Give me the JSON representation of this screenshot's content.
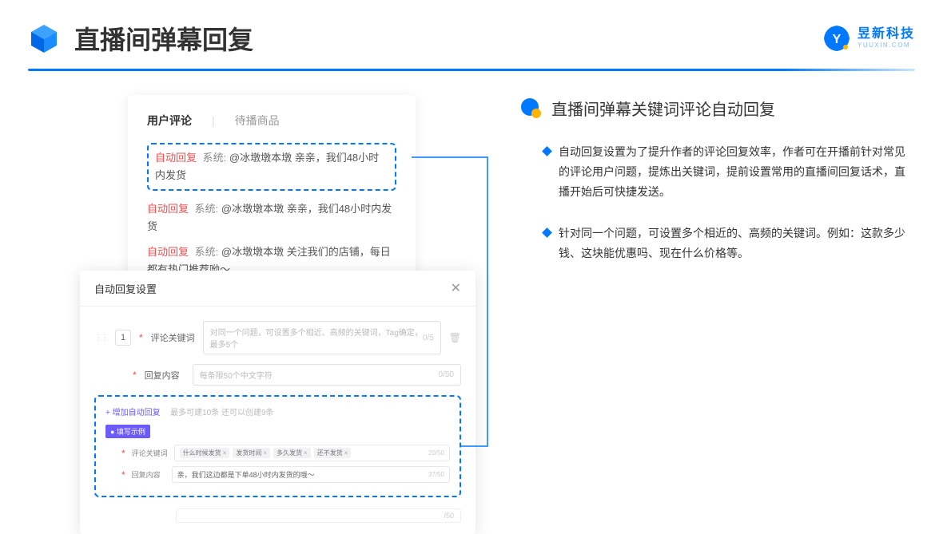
{
  "header": {
    "title": "直播间弹幕回复",
    "logo_name": "昱新科技",
    "logo_domain": "YUUXIN.COM"
  },
  "comments_card": {
    "tab_active": "用户评论",
    "tab_inactive": "待播商品",
    "rows": [
      {
        "tag": "自动回复",
        "sys": "系统:",
        "text": "@冰墩墩本墩 亲亲，我们48小时内发货"
      },
      {
        "tag": "自动回复",
        "sys": "系统:",
        "text": "@冰墩墩本墩 亲亲，我们48小时内发货"
      },
      {
        "tag": "自动回复",
        "sys": "系统:",
        "text": "@冰墩墩本墩 关注我们的店铺，每日都有热门推荐呦～"
      }
    ]
  },
  "settings": {
    "title": "自动回复设置",
    "row_num": "1",
    "keyword_label": "评论关键词",
    "keyword_placeholder": "对同一个问题，可设置多个相近、高频的关键词，Tag确定，最多5个",
    "keyword_counter": "0/5",
    "content_label": "回复内容",
    "content_placeholder": "每条限50个中文字符",
    "content_counter": "0/50",
    "add_link": "+ 增加自动回复",
    "add_hint": "最多可建10条 还可以创建9条",
    "example_badge": "● 填写示例",
    "ex_kw_label": "评论关键词",
    "ex_tags": [
      "什么时候发货",
      "发货时间",
      "多久发货",
      "还不发货"
    ],
    "ex_kw_counter": "20/50",
    "ex_content_label": "回复内容",
    "ex_content_text": "亲，我们这边都是下单48小时内发货的哦～",
    "ex_content_counter": "37/50",
    "bottom_counter": "/50"
  },
  "right": {
    "section_title": "直播间弹幕关键词评论自动回复",
    "bullets": [
      "自动回复设置为了提升作者的评论回复效率，作者可在开播前针对常见的评论用户问题，提炼出关键词，提前设置常用的直播间回复话术，直播开始后可快捷发送。",
      "针对同一个问题，可设置多个相近的、高频的关键词。例如：这款多少钱、这块能优惠吗、现在什么价格等。"
    ]
  }
}
